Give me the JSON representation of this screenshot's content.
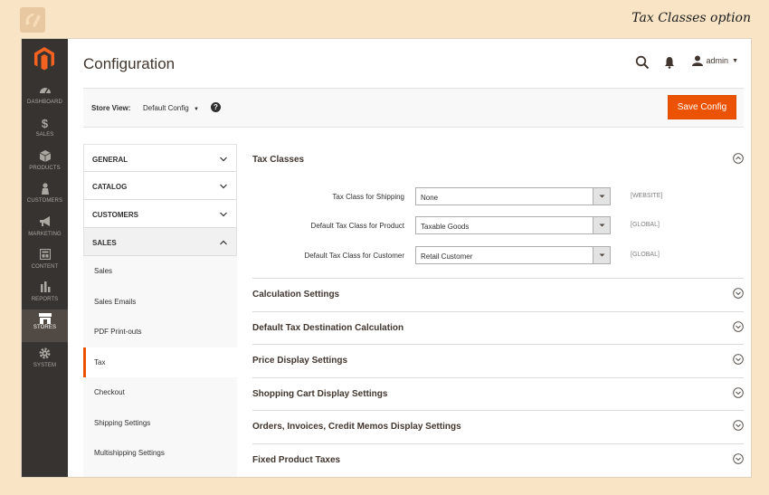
{
  "caption": "Tax Classes option",
  "colors": {
    "accent": "#eb5202",
    "sidebar": "#373330",
    "page_bg": "#f9e5c6"
  },
  "sidebar": {
    "items": [
      {
        "label": "DASHBOARD",
        "icon": "speedometer-icon"
      },
      {
        "label": "SALES",
        "icon": "dollar-icon"
      },
      {
        "label": "PRODUCTS",
        "icon": "cube-icon"
      },
      {
        "label": "CUSTOMERS",
        "icon": "person-icon"
      },
      {
        "label": "MARKETING",
        "icon": "megaphone-icon"
      },
      {
        "label": "CONTENT",
        "icon": "layout-icon"
      },
      {
        "label": "REPORTS",
        "icon": "bar-chart-icon"
      },
      {
        "label": "STORES",
        "icon": "store-icon"
      },
      {
        "label": "SYSTEM",
        "icon": "gear-icon"
      }
    ]
  },
  "header": {
    "title": "Configuration",
    "user": "admin"
  },
  "storebar": {
    "label": "Store View:",
    "value": "Default Config",
    "help": "?",
    "save_label": "Save Config"
  },
  "tabs": {
    "groups": [
      "GENERAL",
      "CATALOG",
      "CUSTOMERS",
      "SALES"
    ],
    "sales_items": [
      "Sales",
      "Sales Emails",
      "PDF Print-outs",
      "Tax",
      "Checkout",
      "Shipping Settings",
      "Multishipping Settings"
    ]
  },
  "content": {
    "open_section": "Tax Classes",
    "fields": [
      {
        "label": "Tax Class for Shipping",
        "value": "None",
        "scope": "[WEBSITE]"
      },
      {
        "label": "Default Tax Class for Product",
        "value": "Taxable Goods",
        "scope": "[GLOBAL]"
      },
      {
        "label": "Default Tax Class for Customer",
        "value": "Retail Customer",
        "scope": "[GLOBAL]"
      }
    ],
    "sections": [
      "Calculation Settings",
      "Default Tax Destination Calculation",
      "Price Display Settings",
      "Shopping Cart Display Settings",
      "Orders, Invoices, Credit Memos Display Settings",
      "Fixed Product Taxes"
    ]
  }
}
